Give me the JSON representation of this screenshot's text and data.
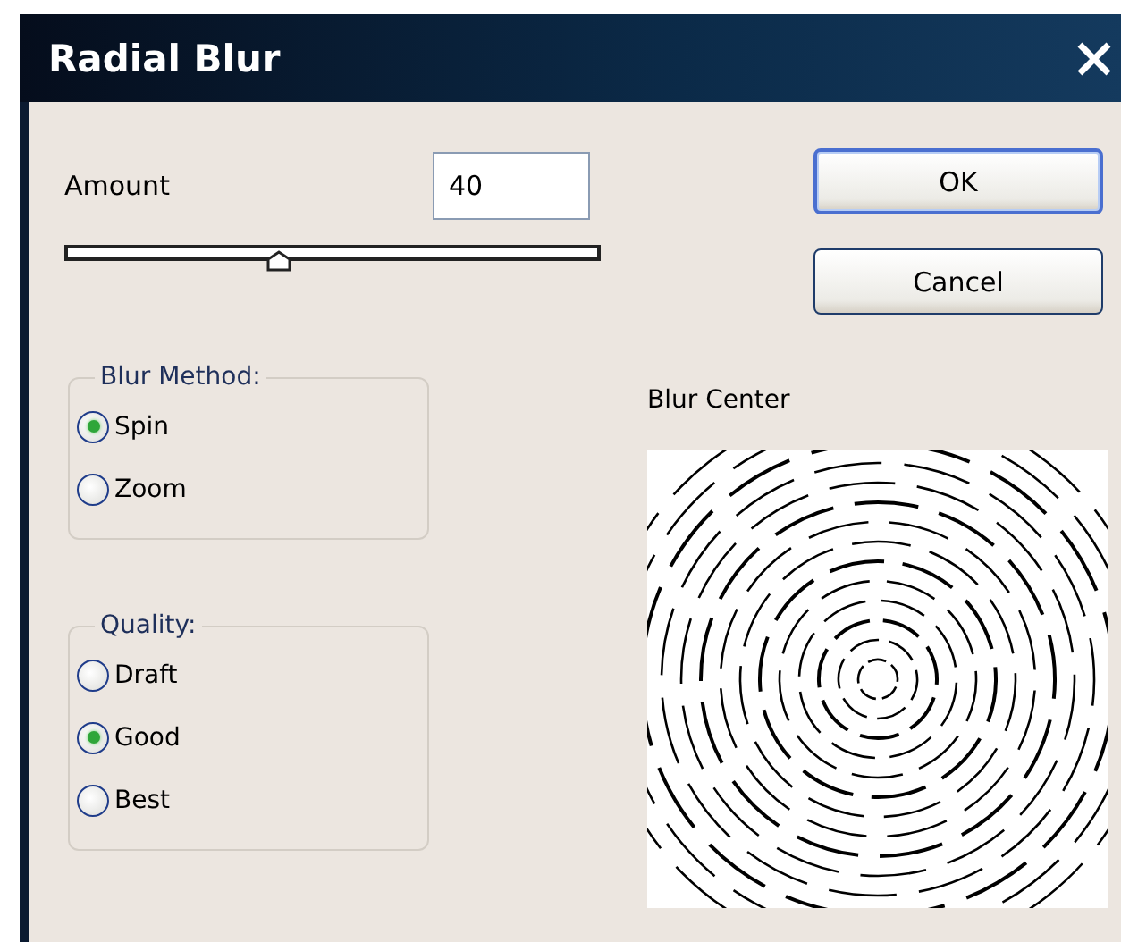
{
  "window": {
    "title": "Radial Blur"
  },
  "amount": {
    "label": "Amount",
    "value": "40",
    "level": 0.4
  },
  "groups": [
    {
      "title": "Blur Method:",
      "options": [
        {
          "label": "Spin",
          "selected": true
        },
        {
          "label": "Zoom",
          "selected": false
        }
      ]
    },
    {
      "title": "Quality:",
      "options": [
        {
          "label": "Draft",
          "selected": false
        },
        {
          "label": "Good",
          "selected": true
        },
        {
          "label": "Best",
          "selected": false
        }
      ]
    }
  ],
  "preview": {
    "label": "Blur Center"
  },
  "buttons": [
    {
      "label": "OK",
      "default": true
    },
    {
      "label": "Cancel",
      "default": false
    }
  ]
}
